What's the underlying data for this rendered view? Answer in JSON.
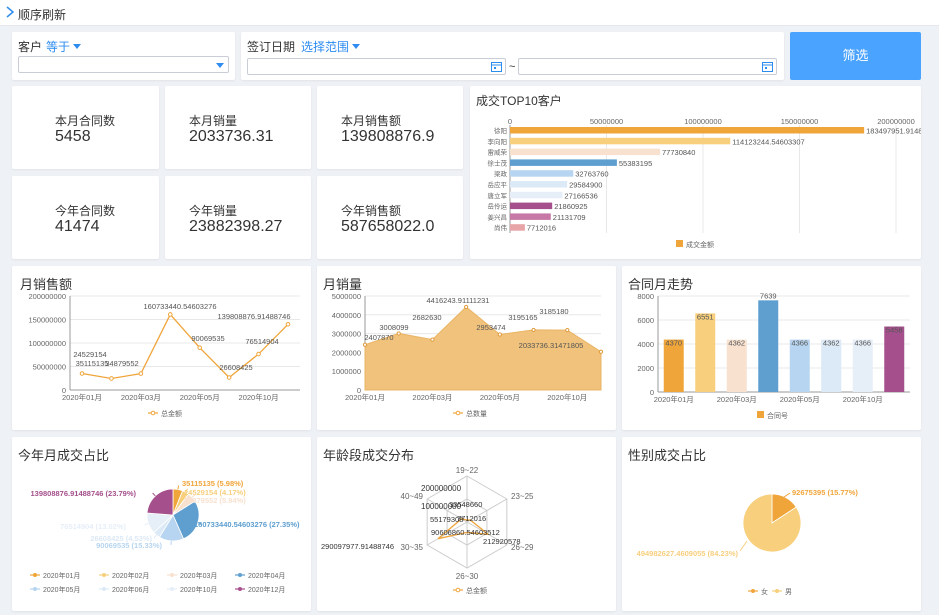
{
  "breadcrumb": {
    "title": "顺序刷新"
  },
  "filters": {
    "customer_label": "客户",
    "customer_op": "等于",
    "date_label": "签订日期",
    "date_op": "选择范围",
    "range_sep": "~",
    "button": "筛选"
  },
  "kpis": [
    {
      "label": "本月合同数",
      "value": "5458"
    },
    {
      "label": "本月销量",
      "value": "2033736.31"
    },
    {
      "label": "本月销售额",
      "value": "139808876.9"
    },
    {
      "label": "今年合同数",
      "value": "41474"
    },
    {
      "label": "今年销量",
      "value": "23882398.27"
    },
    {
      "label": "今年销售额",
      "value": "587658022.0"
    }
  ],
  "colors": {
    "accent": "#4aa3ff",
    "line": "#f0a53b",
    "area": "#f0c27b"
  },
  "chart_data": [
    {
      "id": "top10",
      "type": "bar",
      "orientation": "horizontal",
      "title": "成交TOP10客户",
      "categories": [
        "徐阳",
        "李向阳",
        "雷威荣",
        "徐士茂",
        "梁政",
        "岳应平",
        "唐立军",
        "岳伶运",
        "姜兴昌",
        "尚伟"
      ],
      "values": [
        183497951.91488767,
        114123244.54603307,
        77730840,
        55383195,
        32763760,
        29584900,
        27166536,
        21860925,
        21131709,
        7712016
      ],
      "labels": [
        "183497951.91488767",
        "114123244.54603307",
        "77730840",
        "55383195",
        "32763760",
        "29584900",
        "27166536",
        "21860925",
        "21131709",
        "7712016"
      ],
      "colors": [
        "#f0a53b",
        "#f7cf7d",
        "#f8e1cf",
        "#5e9fd0",
        "#b7d5f0",
        "#dce9f6",
        "#e6eef8",
        "#a5508c",
        "#c878a6",
        "#e8a5a8"
      ],
      "xticks": [
        "0",
        "50000000",
        "100000000",
        "150000000",
        "200000000"
      ],
      "xlim": [
        0,
        200000000
      ],
      "legend": "成交金额",
      "legend_position": "bottom"
    },
    {
      "id": "monthly-sales-amount",
      "type": "line",
      "title": "月销售额",
      "categories": [
        "2020年01月",
        "2020年02月",
        "2020年03月",
        "2020年04月",
        "2020年05月",
        "2020年06月",
        "2020年10月",
        "2020年12月"
      ],
      "xticks": [
        "2020年01月",
        "2020年03月",
        "2020年05月",
        "2020年10月"
      ],
      "values": [
        35115135,
        24529154,
        34879552,
        160733440.54603276,
        90069535,
        26608425,
        76514904,
        139808876.91488746
      ],
      "labels": [
        "35115135",
        "24529154",
        "34879552",
        "160733440.54603276",
        "90069535",
        "26608425",
        "76514904",
        "139808876.91488746"
      ],
      "yticks": [
        "0",
        "50000000",
        "100000000",
        "150000000",
        "200000000"
      ],
      "ylim": [
        0,
        200000000
      ],
      "legend": "总金额",
      "legend_position": "bottom"
    },
    {
      "id": "monthly-volume",
      "type": "area",
      "title": "月销量",
      "categories": [
        "2020年01月",
        "2020年02月",
        "2020年03月",
        "2020年04月",
        "2020年05月",
        "2020年06月",
        "2020年10月",
        "2020年12月"
      ],
      "xticks": [
        "2020年01月",
        "2020年03月",
        "2020年05月",
        "2020年10月"
      ],
      "values": [
        2407870,
        3008099,
        2682630,
        4416243.91111231,
        2953474,
        3195165,
        3185180,
        2033736.31471805
      ],
      "labels": [
        "2407870",
        "3008099",
        "2682630",
        "4416243.91111231",
        "2953474",
        "3195165",
        "3185180",
        "2033736.31471805"
      ],
      "yticks": [
        "0",
        "1000000",
        "2000000",
        "3000000",
        "4000000",
        "5000000"
      ],
      "ylim": [
        0,
        5000000
      ],
      "legend": "总数量",
      "legend_position": "bottom"
    },
    {
      "id": "contract-trend",
      "type": "bar",
      "title": "合同月走势",
      "categories": [
        "2020年01月",
        "2020年02月",
        "2020年03月",
        "2020年04月",
        "2020年05月",
        "2020年06月",
        "2020年10月",
        "2020年12月"
      ],
      "xticks": [
        "2020年01月",
        "2020年03月",
        "2020年05月",
        "2020年10月"
      ],
      "values": [
        4370,
        6551,
        4362,
        7639,
        4366,
        4362,
        4366,
        5458
      ],
      "colors": [
        "#f0a53b",
        "#f7cf7d",
        "#f8e1cf",
        "#5e9fd0",
        "#b7d5f0",
        "#dce9f6",
        "#e6eef8",
        "#a5508c"
      ],
      "yticks": [
        "0",
        "2000",
        "4000",
        "6000",
        "8000"
      ],
      "ylim": [
        0,
        8000
      ],
      "legend": "合同号",
      "legend_position": "bottom"
    },
    {
      "id": "year-month-share",
      "type": "pie",
      "title": "今年月成交占比",
      "categories": [
        "2020年01月",
        "2020年02月",
        "2020年03月",
        "2020年04月",
        "2020年05月",
        "2020年06月",
        "2020年10月",
        "2020年12月"
      ],
      "values": [
        35115135,
        24529154,
        34879552,
        160733440.54603276,
        90069535,
        26608425,
        76514904,
        139808876.91488746
      ],
      "labels": [
        "35115135 (5.98%)",
        "24529154 (4.17%)",
        "34879552 (5.94%)",
        "160733440.54603276 (27.35%)",
        "90069535 (15.33%)",
        "26608425 (4.53%)",
        "76514904 (13.02%)",
        "139808876.91488746 (23.79%)"
      ],
      "colors": [
        "#f0a53b",
        "#f7cf7d",
        "#f8e1cf",
        "#5e9fd0",
        "#b7d5f0",
        "#dce9f6",
        "#e6eef8",
        "#a5508c"
      ],
      "legend_position": "bottom"
    },
    {
      "id": "age-distribution",
      "type": "radar",
      "title": "年龄段成交分布",
      "axes": [
        "19~22",
        "23~25",
        "26~29",
        "26~30",
        "30~35",
        "40~49"
      ],
      "values": [
        17712016,
        33548660,
        212920578,
        90606860.54603513,
        290097977.9148875,
        55179308
      ],
      "labels": [
        "7712016",
        "33548660",
        "212920578",
        "90606860.54603512",
        "290097977.91488746",
        "55179308"
      ],
      "rticks": [
        "100000000",
        "200000000"
      ],
      "legend": "总金额",
      "legend_position": "bottom"
    },
    {
      "id": "gender-share",
      "type": "pie",
      "title": "性别成交占比",
      "categories": [
        "女",
        "男"
      ],
      "values": [
        92675395,
        494982627.4609055
      ],
      "labels": [
        "92675395 (15.77%)",
        "494982627.4609055 (84.23%)"
      ],
      "colors": [
        "#f0a53b",
        "#f7cf7d"
      ],
      "legend_position": "bottom"
    }
  ]
}
